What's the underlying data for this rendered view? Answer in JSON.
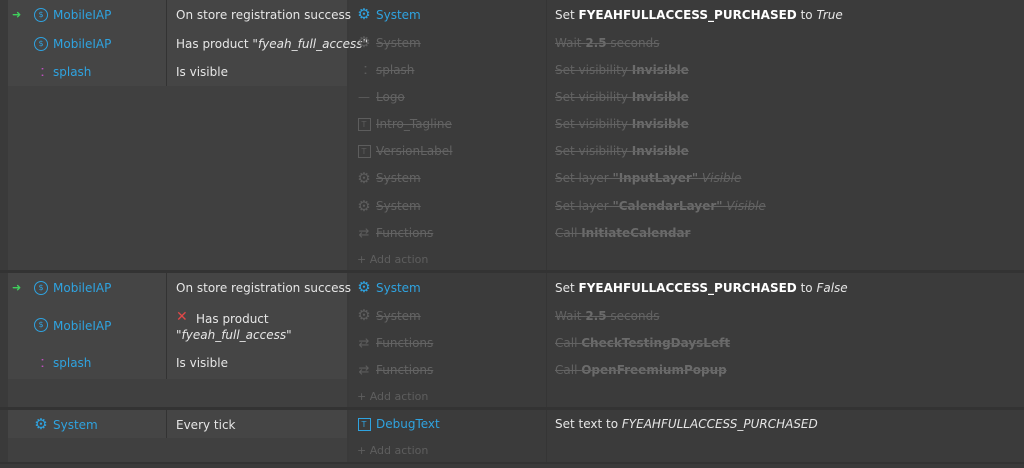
{
  "events": [
    {
      "conditions": [
        {
          "trigger": "➜",
          "object": "MobileIAP",
          "text_plain": "On store registration success"
        },
        {
          "object": "MobileIAP",
          "text_pre": "Has product ",
          "text_italic": "\"fyeah_full_access\""
        },
        {
          "object": "splash",
          "text_plain": "Is visible"
        }
      ],
      "actions": [
        {
          "object": "System",
          "pre": "Set ",
          "bold": "FYEAHFULLACCESS_PURCHASED",
          "mid": " to ",
          "italic": "True",
          "disabled": false
        },
        {
          "object": "System",
          "pre": "Wait ",
          "bold": "2.5",
          "mid": " seconds",
          "disabled": true
        },
        {
          "object": "splash",
          "pre": "Set visibility ",
          "bold": "Invisible",
          "disabled": true
        },
        {
          "object": "Logo",
          "pre": "Set visibility ",
          "bold": "Invisible",
          "disabled": true
        },
        {
          "object": "Intro_Tagline",
          "pre": "Set visibility ",
          "bold": "Invisible",
          "disabled": true
        },
        {
          "object": "VersionLabel",
          "pre": "Set visibility ",
          "bold": "Invisible",
          "disabled": true
        },
        {
          "object": "System",
          "pre": "Set layer ",
          "bold": "\"InputLayer\"",
          "italic": " Visible",
          "disabled": true
        },
        {
          "object": "System",
          "pre": "Set layer ",
          "bold": "\"CalendarLayer\"",
          "italic": " Visible",
          "disabled": true
        },
        {
          "object": "Functions",
          "pre": "Call ",
          "bold": "InitiateCalendar",
          "disabled": true
        }
      ],
      "add_action": "+ Add action"
    },
    {
      "conditions": [
        {
          "trigger": "➜",
          "object": "MobileIAP",
          "text_plain": "On store registration success"
        },
        {
          "object": "MobileIAP",
          "text_pre": "Has product",
          "text_italic": "\"fyeah_full_access\"",
          "inverted": "✕"
        },
        {
          "object": "splash",
          "text_plain": "Is visible"
        }
      ],
      "actions": [
        {
          "object": "System",
          "pre": "Set ",
          "bold": "FYEAHFULLACCESS_PURCHASED",
          "mid": " to ",
          "italic": "False",
          "disabled": false
        },
        {
          "object": "System",
          "pre": "Wait ",
          "bold": "2.5",
          "mid": " seconds",
          "disabled": true
        },
        {
          "object": "Functions",
          "pre": "Call ",
          "bold": "CheckTestingDaysLeft",
          "disabled": true
        },
        {
          "object": "Functions",
          "pre": "Call ",
          "bold": "OpenFreemiumPopup",
          "disabled": true
        }
      ],
      "add_action": "+ Add action"
    },
    {
      "conditions": [
        {
          "object": "System",
          "text_plain": "Every tick"
        }
      ],
      "actions": [
        {
          "object": "DebugText",
          "pre": "Set text to ",
          "italic": "FYEAHFULLACCESS_PURCHASED",
          "disabled": false
        }
      ],
      "add_action": "+ Add action"
    }
  ],
  "colors": {
    "object": "#2fa3e0",
    "trigger": "#3fcf5c",
    "disabled": "#636363",
    "invert": "#e04848"
  },
  "icons": {
    "mobileiap": "mobileiap-icon",
    "system": "gear-icon",
    "sprite": "sprite-icon",
    "text": "text-object-icon",
    "functions": "functions-icon",
    "invert": "invert-x-icon",
    "trigger": "trigger-arrow-icon"
  }
}
